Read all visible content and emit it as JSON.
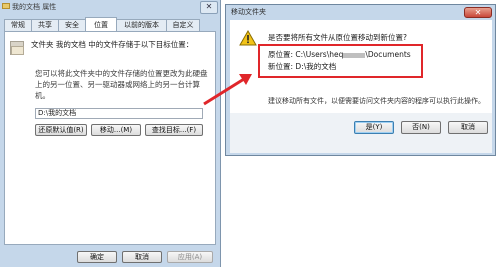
{
  "properties": {
    "title": "我的文档 属性",
    "close_glyph": "✕",
    "tabs": [
      "常规",
      "共享",
      "安全",
      "位置",
      "以前的版本",
      "自定义"
    ],
    "description": "文件夹 我的文档 中的文件存储于以下目标位置：",
    "instructions": "您可以将此文件夹中的文件存储的位置更改为此硬盘上的另一位置、另一驱动器或网络上的另一台计算机。",
    "path_value": "D:\\我的文档",
    "buttons": {
      "restore": "还原默认值(R)",
      "move": "移动...(M)",
      "find_target": "查找目标...(F)"
    },
    "footer": {
      "ok": "确定",
      "cancel": "取消",
      "apply": "应用(A)"
    }
  },
  "move_dialog": {
    "title": "移动文件夹",
    "close_glyph": "✕",
    "question": "是否要将所有文件从原位置移动到新位置?",
    "original_label": "原位置:",
    "original_prefix": "C:\\Users\\heq",
    "original_suffix": "\\Documents",
    "new_label": "新位置:",
    "new_value": "D:\\我的文档",
    "advice": "建议移动所有文件，以便需要访问文件夹内容的程序可以执行此操作。",
    "buttons": {
      "yes": "是(Y)",
      "no": "否(N)",
      "cancel": "取消"
    }
  },
  "icons": {
    "warning": "warning-icon",
    "folder": "folder-icon",
    "arrow": "red-arrow-annotation"
  },
  "colors": {
    "highlight_red": "#e0262a",
    "window_frame": "#c5d7ea",
    "warning_yellow": "#f2c318"
  }
}
